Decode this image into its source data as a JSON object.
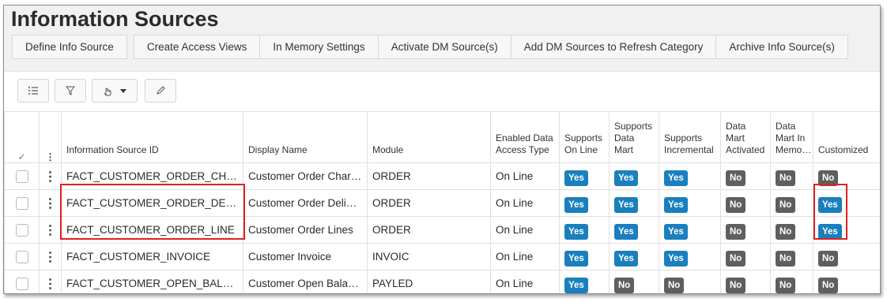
{
  "page": {
    "title": "Information Sources"
  },
  "actions": [
    "Define Info Source",
    "Create Access Views",
    "In Memory Settings",
    "Activate DM Source(s)",
    "Add DM Sources to Refresh Category",
    "Archive Info Source(s)"
  ],
  "toolbar": {
    "icons": [
      "list-settings-icon",
      "filter-icon",
      "hand-pointer-icon",
      "chevron-down-icon",
      "pencil-icon"
    ]
  },
  "table": {
    "header_check": "✓",
    "header_menu": "⋮",
    "columns": [
      "Information Source ID",
      "Display Name",
      "Module",
      "Enabled Data Access Type",
      "Supports On Line",
      "Supports Data Mart",
      "Supports Incremental",
      "Data Mart Activated",
      "Data Mart In Memo…",
      "Customized"
    ],
    "rows": [
      {
        "id": "FACT_CUSTOMER_ORDER_CHARGE",
        "display": "Customer Order Charge",
        "module": "ORDER",
        "access": "On Line",
        "online": "Yes",
        "datamart": "Yes",
        "incremental": "Yes",
        "activated": "No",
        "inmemory": "No",
        "customized": "No"
      },
      {
        "id": "FACT_CUSTOMER_ORDER_DELIV",
        "display": "Customer Order Deliv…",
        "module": "ORDER",
        "access": "On Line",
        "online": "Yes",
        "datamart": "Yes",
        "incremental": "Yes",
        "activated": "No",
        "inmemory": "No",
        "customized": "Yes"
      },
      {
        "id": "FACT_CUSTOMER_ORDER_LINE",
        "display": "Customer Order Lines",
        "module": "ORDER",
        "access": "On Line",
        "online": "Yes",
        "datamart": "Yes",
        "incremental": "Yes",
        "activated": "No",
        "inmemory": "No",
        "customized": "Yes"
      },
      {
        "id": "FACT_CUSTOMER_INVOICE",
        "display": "Customer Invoice",
        "module": "INVOIC",
        "access": "On Line",
        "online": "Yes",
        "datamart": "Yes",
        "incremental": "Yes",
        "activated": "No",
        "inmemory": "No",
        "customized": "No"
      },
      {
        "id": "FACT_CUSTOMER_OPEN_BALANCE",
        "display": "Customer Open Balance",
        "module": "PAYLED",
        "access": "On Line",
        "online": "Yes",
        "datamart": "No",
        "incremental": "No",
        "activated": "No",
        "inmemory": "No",
        "customized": "No"
      }
    ]
  },
  "colors": {
    "yes_badge": "#1a7fbf",
    "no_badge": "#5f5f5f",
    "highlight": "#e02020"
  }
}
